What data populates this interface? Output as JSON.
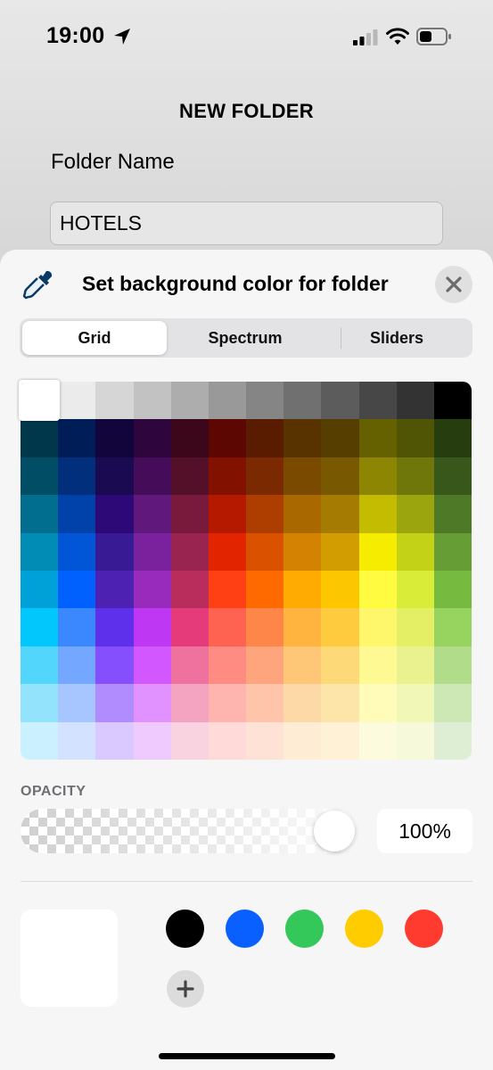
{
  "status_bar": {
    "time": "19:00",
    "icons": [
      "location-arrow-icon",
      "cellular-signal-icon",
      "wifi-icon",
      "battery-icon"
    ]
  },
  "page": {
    "title": "NEW FOLDER",
    "field_label": "Folder Name",
    "folder_name_value": "HOTELS"
  },
  "sheet": {
    "title": "Set background color for folder",
    "eyedropper_icon": "eyedropper-icon",
    "close_icon": "close-icon",
    "tabs": [
      {
        "label": "Grid",
        "active": true
      },
      {
        "label": "Spectrum",
        "active": false
      },
      {
        "label": "Sliders",
        "active": false
      }
    ],
    "grid_colors": [
      [
        "#ffffff",
        "#ebebeb",
        "#d6d6d6",
        "#c2c2c2",
        "#adadad",
        "#999999",
        "#858585",
        "#707070",
        "#5c5c5c",
        "#474747",
        "#333333",
        "#000000"
      ],
      [
        "#00374a",
        "#011d57",
        "#11053b",
        "#2e063d",
        "#3c071b",
        "#5c0701",
        "#5a1c00",
        "#583300",
        "#563d00",
        "#666100",
        "#4f5504",
        "#263e0f"
      ],
      [
        "#004d65",
        "#012f7b",
        "#1a0a52",
        "#450d59",
        "#551029",
        "#831100",
        "#7b2900",
        "#7a4a00",
        "#785800",
        "#8c8602",
        "#6f760a",
        "#38571a"
      ],
      [
        "#016e8f",
        "#0042a9",
        "#2c0977",
        "#61187c",
        "#791a3d",
        "#b51a00",
        "#ad3e00",
        "#a96800",
        "#a67b01",
        "#c4bc00",
        "#9ba50e",
        "#4e7a27"
      ],
      [
        "#008cb4",
        "#0056d6",
        "#371a94",
        "#7a219e",
        "#99244f",
        "#e22400",
        "#da5100",
        "#d38301",
        "#d19d01",
        "#f5ec00",
        "#c3d117",
        "#669d34"
      ],
      [
        "#00a1d8",
        "#0061fe",
        "#4d22b2",
        "#982abc",
        "#b92d5d",
        "#ff4015",
        "#ff6a00",
        "#ffab01",
        "#fdc700",
        "#fefb41",
        "#d9ec37",
        "#76bb40"
      ],
      [
        "#01c7fc",
        "#3a87fe",
        "#5e30eb",
        "#be38f3",
        "#e63b7a",
        "#fe6250",
        "#fe8648",
        "#feb43f",
        "#fecb3e",
        "#fff76b",
        "#e4ef65",
        "#96d35f"
      ],
      [
        "#52d6fc",
        "#74a7ff",
        "#864ffe",
        "#d357fe",
        "#ee719e",
        "#ff8c82",
        "#fea57d",
        "#fec777",
        "#fed977",
        "#fff994",
        "#eaf28f",
        "#b1dd8b"
      ],
      [
        "#93e3fc",
        "#a7c6ff",
        "#b18cfe",
        "#e292fe",
        "#f4a4c0",
        "#ffb5af",
        "#ffc5ab",
        "#fed9a8",
        "#fde4a8",
        "#fffbb9",
        "#f1f7b7",
        "#cde8b5"
      ],
      [
        "#cbf0ff",
        "#d3e2ff",
        "#d9c9fe",
        "#efcaff",
        "#f9d3e0",
        "#ffdad8",
        "#ffe2d6",
        "#feecd4",
        "#fef1d5",
        "#fdfbdd",
        "#f6fadb",
        "#deeed4"
      ]
    ],
    "selected_color": "#ffffff",
    "opacity": {
      "label": "OPACITY",
      "value_text": "100%",
      "fraction": 1.0
    },
    "current_color": "#ffffff",
    "saved_colors": [
      {
        "name": "black",
        "hex": "#000000"
      },
      {
        "name": "blue",
        "hex": "#0a60ff"
      },
      {
        "name": "green",
        "hex": "#34c759"
      },
      {
        "name": "yellow",
        "hex": "#ffcc00"
      },
      {
        "name": "red",
        "hex": "#ff3b30"
      }
    ],
    "add_icon": "plus-icon"
  }
}
